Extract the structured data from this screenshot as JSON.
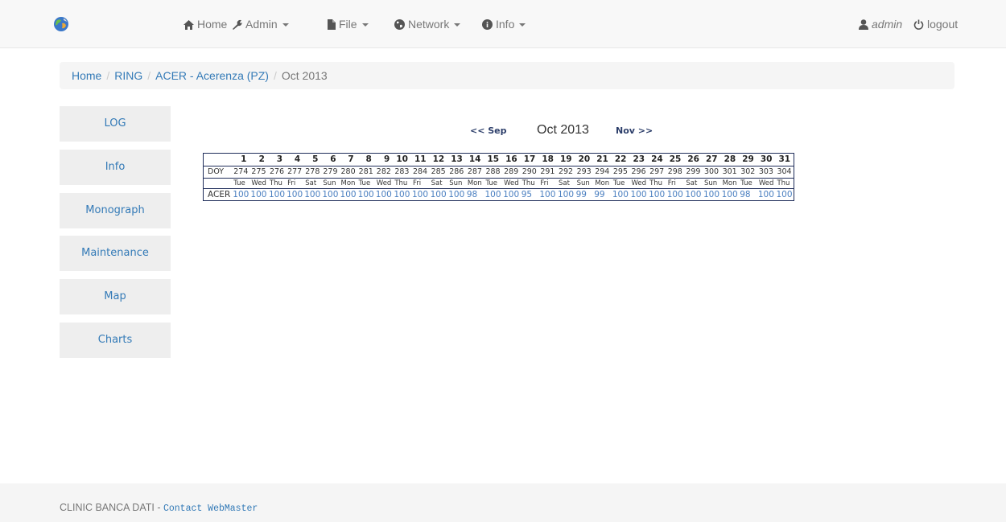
{
  "navbar": {
    "home": "Home",
    "admin": "Admin",
    "file": "File",
    "network": "Network",
    "info": "Info",
    "user": "admin",
    "logout": "logout"
  },
  "breadcrumb": [
    "Home",
    "RING",
    "ACER - Acerenza (PZ)",
    "Oct 2013"
  ],
  "sidebar": [
    "LOG",
    "Info",
    "Monograph",
    "Maintenance",
    "Map",
    "Charts"
  ],
  "month_nav": {
    "prev": "<< Sep",
    "current": "Oct 2013",
    "next": "Nov >>"
  },
  "calendar": {
    "days": [
      "1",
      "2",
      "3",
      "4",
      "5",
      "6",
      "7",
      "8",
      "9",
      "10",
      "11",
      "12",
      "13",
      "14",
      "15",
      "16",
      "17",
      "18",
      "19",
      "20",
      "21",
      "22",
      "23",
      "24",
      "25",
      "26",
      "27",
      "28",
      "29",
      "30",
      "31"
    ],
    "doy_label": "DOY",
    "doy": [
      "274",
      "275",
      "276",
      "277",
      "278",
      "279",
      "280",
      "281",
      "282",
      "283",
      "284",
      "285",
      "286",
      "287",
      "288",
      "289",
      "290",
      "291",
      "292",
      "293",
      "294",
      "295",
      "296",
      "297",
      "298",
      "299",
      "300",
      "301",
      "302",
      "303",
      "304"
    ],
    "weekdays": [
      "Tue",
      "Wed",
      "Thu",
      "Fri",
      "Sat",
      "Sun",
      "Mon",
      "Tue",
      "Wed",
      "Thu",
      "Fri",
      "Sat",
      "Sun",
      "Mon",
      "Tue",
      "Wed",
      "Thu",
      "Fri",
      "Sat",
      "Sun",
      "Mon",
      "Tue",
      "Wed",
      "Thu",
      "Fri",
      "Sat",
      "Sun",
      "Mon",
      "Tue",
      "Wed",
      "Thu"
    ],
    "station": "ACER",
    "values": [
      "100",
      "100",
      "100",
      "100",
      "100",
      "100",
      "100",
      "100",
      "100",
      "100",
      "100",
      "100",
      "100",
      "98",
      "100",
      "100",
      "95",
      "100",
      "100",
      "99",
      "99",
      "100",
      "100",
      "100",
      "100",
      "100",
      "100",
      "100",
      "98",
      "100",
      "100"
    ]
  },
  "footer": {
    "text": "CLINIC BANCA DATI - ",
    "link": "Contact WebMaster"
  }
}
